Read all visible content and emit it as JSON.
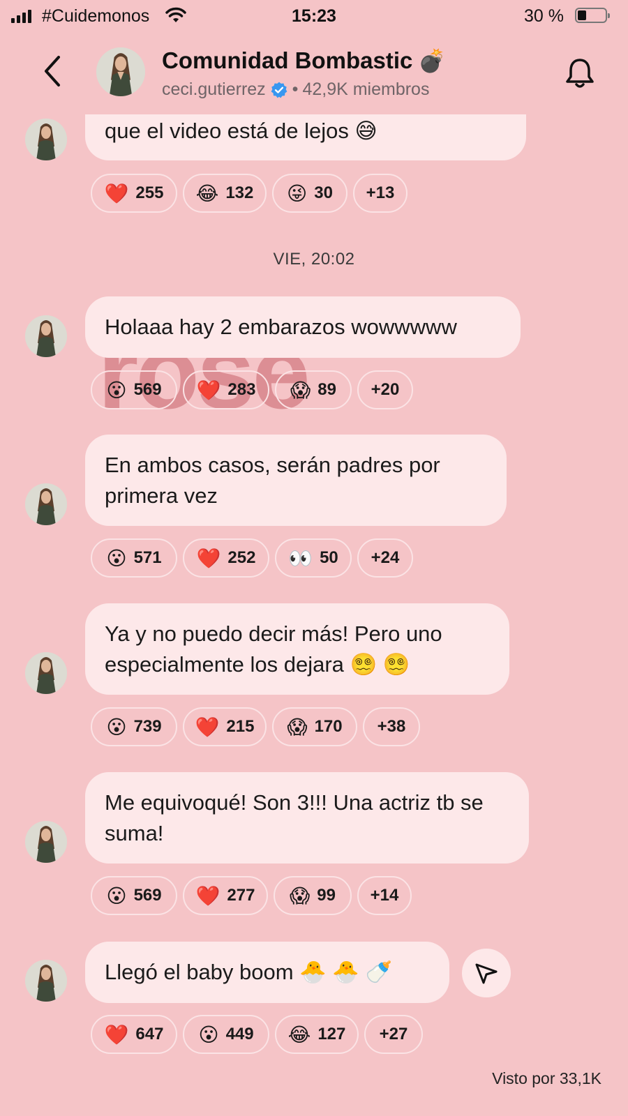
{
  "status_bar": {
    "carrier": "#Cuidemonos",
    "time": "15:23",
    "battery_percent": "30 %",
    "battery_level": 0.3
  },
  "header": {
    "title": "Comunidad Bombastic",
    "title_emoji": "💣",
    "author": "ceci.gutierrez",
    "separator": "•",
    "members": "42,9K miembros",
    "icons": [
      "back-icon",
      "avatar",
      "verified-icon",
      "bell-icon"
    ]
  },
  "watermark": "rosé",
  "day_label": "VIE, 20:02",
  "messages": [
    {
      "text": "que el video está de lejos 😅",
      "reactions": [
        {
          "emoji": "❤️",
          "count": "255"
        },
        {
          "emoji": "😂",
          "count": "132"
        },
        {
          "emoji": "😜",
          "count": "30"
        },
        {
          "emoji": "",
          "count": "+13"
        }
      ]
    },
    {
      "text": "Holaaa hay 2 embarazos wowwwww",
      "reactions": [
        {
          "emoji": "😮",
          "count": "569"
        },
        {
          "emoji": "❤️",
          "count": "283"
        },
        {
          "emoji": "😱",
          "count": "89"
        },
        {
          "emoji": "",
          "count": "+20"
        }
      ]
    },
    {
      "text": "En ambos casos, serán padres por primera vez",
      "reactions": [
        {
          "emoji": "😮",
          "count": "571"
        },
        {
          "emoji": "❤️",
          "count": "252"
        },
        {
          "emoji": "👀",
          "count": "50"
        },
        {
          "emoji": "",
          "count": "+24"
        }
      ]
    },
    {
      "text": "Ya y no puedo decir más! Pero uno especialmente los dejara 😵‍💫 😵‍💫",
      "reactions": [
        {
          "emoji": "😮",
          "count": "739"
        },
        {
          "emoji": "❤️",
          "count": "215"
        },
        {
          "emoji": "😱",
          "count": "170"
        },
        {
          "emoji": "",
          "count": "+38"
        }
      ]
    },
    {
      "text": "Me equivoqué! Son 3!!! Una actriz tb se suma!",
      "reactions": [
        {
          "emoji": "😮",
          "count": "569"
        },
        {
          "emoji": "❤️",
          "count": "277"
        },
        {
          "emoji": "😱",
          "count": "99"
        },
        {
          "emoji": "",
          "count": "+14"
        }
      ]
    },
    {
      "text": "Llegó el baby boom 🐣 🐣 🍼",
      "reactions": [
        {
          "emoji": "❤️",
          "count": "647"
        },
        {
          "emoji": "😮",
          "count": "449"
        },
        {
          "emoji": "😂",
          "count": "127"
        },
        {
          "emoji": "",
          "count": "+27"
        }
      ]
    }
  ],
  "seen_by": "Visto por 33,1K",
  "colors": {
    "background": "#f5c4c7",
    "bubble": "#fde8e9",
    "verified": "#3897f0",
    "watermark": "#d47c84"
  }
}
